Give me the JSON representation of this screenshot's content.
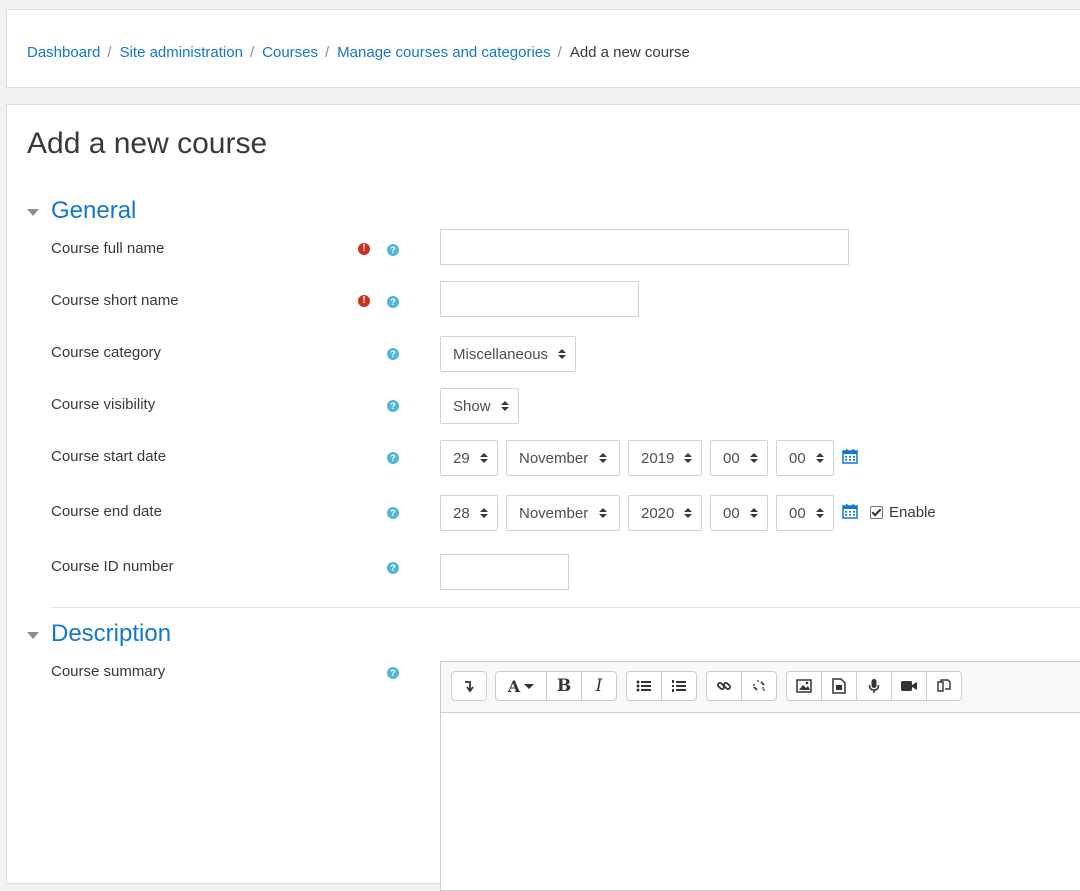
{
  "breadcrumb": {
    "items": [
      "Dashboard",
      "Site administration",
      "Courses",
      "Manage courses and categories"
    ],
    "separator": "/",
    "current": "Add a new course"
  },
  "page": {
    "title": "Add a new course"
  },
  "general": {
    "title": "General",
    "fields": {
      "full_name": {
        "label": "Course full name",
        "value": ""
      },
      "short_name": {
        "label": "Course short name",
        "value": ""
      },
      "category": {
        "label": "Course category",
        "selected": "Miscellaneous"
      },
      "visibility": {
        "label": "Course visibility",
        "selected": "Show"
      },
      "start_date": {
        "label": "Course start date",
        "day": "29",
        "month": "November",
        "year": "2019",
        "hour": "00",
        "minute": "00"
      },
      "end_date": {
        "label": "Course end date",
        "day": "28",
        "month": "November",
        "year": "2020",
        "hour": "00",
        "minute": "00",
        "enable_label": "Enable",
        "enabled": true
      },
      "id_number": {
        "label": "Course ID number",
        "value": ""
      }
    }
  },
  "description": {
    "title": "Description",
    "summary_label": "Course summary",
    "editor_toolbar": [
      [
        "collapse-icon"
      ],
      [
        "font-style-icon",
        "bold-icon",
        "italic-icon"
      ],
      [
        "unordered-list-icon",
        "ordered-list-icon"
      ],
      [
        "link-icon",
        "unlink-icon"
      ],
      [
        "image-icon",
        "media-icon",
        "audio-record-icon",
        "video-record-icon",
        "manage-files-icon"
      ]
    ]
  },
  "icons": {
    "required": "!",
    "help": "?"
  },
  "colors": {
    "link": "#1177d1",
    "required": "#ca3120",
    "help": "#4fb5d9"
  }
}
